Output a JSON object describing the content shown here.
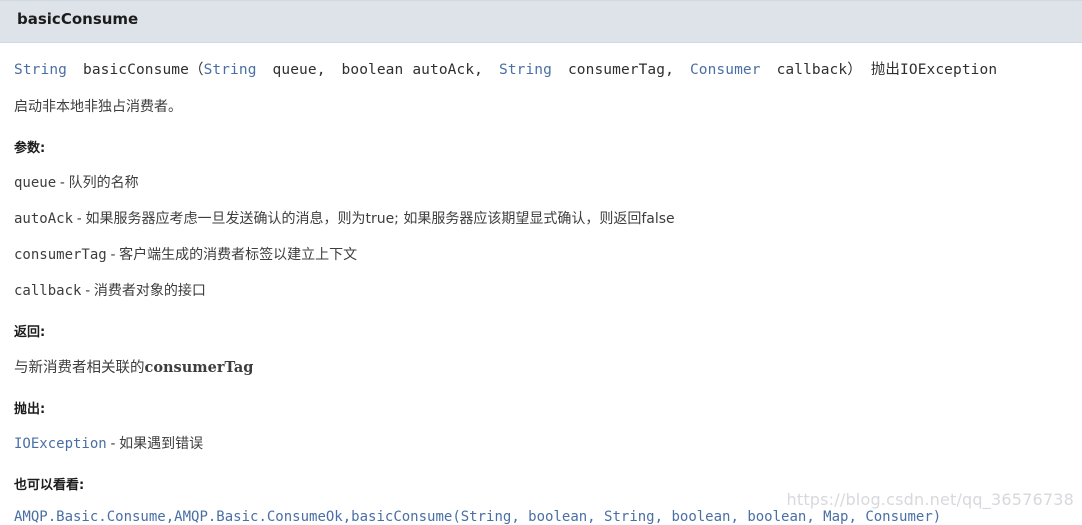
{
  "header": {
    "title": "basicConsume"
  },
  "signature": {
    "return_type": "String",
    "method_name": "basicConsume",
    "open_paren": "（",
    "close_paren": "）",
    "params": [
      {
        "type": "String",
        "type_is_link": true,
        "name": "queue,"
      },
      {
        "type": "boolean",
        "type_is_link": false,
        "name": "autoAck,"
      },
      {
        "type": "String",
        "type_is_link": true,
        "name": "consumerTag,"
      },
      {
        "type": "Consumer",
        "type_is_link": true,
        "name": "callback"
      }
    ],
    "throws_keyword": "抛出",
    "throws_type": "IOException"
  },
  "description": "启动非本地非独占消费者。",
  "sections": {
    "params": {
      "title": "参数:",
      "items": [
        {
          "name": "queue",
          "dash": "-",
          "text": "队列的名称"
        },
        {
          "name": "autoAck",
          "dash": "-",
          "text": "如果服务器应考虑一旦发送确认的消息，则为true; 如果服务器应该期望显式确认，则返回false"
        },
        {
          "name": "consumerTag",
          "dash": "-",
          "text": "客户端生成的消费者标签以建立上下文"
        },
        {
          "name": "callback",
          "dash": "-",
          "text": "消费者对象的接口"
        }
      ]
    },
    "returns": {
      "title": "返回:",
      "text_before": "与新消费者相关联的",
      "code": "consumerTag",
      "text_after": ""
    },
    "throws": {
      "title": "抛出:",
      "items": [
        {
          "name": "IOException",
          "dash": "-",
          "text": "如果遇到错误"
        }
      ]
    },
    "see_also": {
      "title": "也可以看看:",
      "links": [
        "AMQP.Basic.Consume,",
        "AMQP.Basic.ConsumeOk,",
        "basicConsume(String, boolean, String, boolean, boolean, Map, Consumer)"
      ]
    }
  },
  "watermark": "https://blog.csdn.net/qq_36576738",
  "colors": {
    "header_bg": "#dee3e9",
    "link": "#4a6fa5",
    "text": "#3d3d3d",
    "watermark": "#d8d8dd"
  }
}
